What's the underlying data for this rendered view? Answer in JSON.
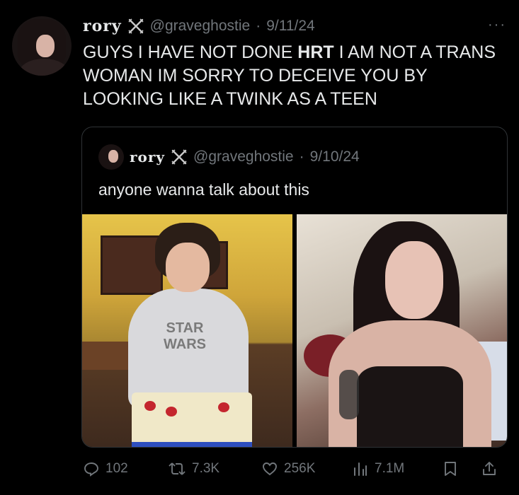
{
  "tweet": {
    "name": "rory",
    "handle": "@graveghostie",
    "separator": "·",
    "date": "9/11/24",
    "text_prefix": "GUYS I HAVE NOT DONE ",
    "text_bold": "HRT",
    "text_suffix": " I AM NOT A TRANS WOMAN IM SORRY TO DECEIVE YOU BY LOOKING LIKE A TWINK AS A TEEN",
    "more": "···"
  },
  "quote": {
    "name": "rory",
    "handle": "@graveghostie",
    "separator": "·",
    "date": "9/10/24",
    "text": "anyone wanna talk about this",
    "left_photo_shirt_text": "STAR WARS"
  },
  "actions": {
    "replies": "102",
    "retweets": "7.3K",
    "likes": "256K",
    "views": "7.1M"
  },
  "colors": {
    "background": "#000000",
    "text": "#e7e9ea",
    "muted": "#71767b",
    "border": "#2f3336"
  },
  "icons": [
    "swords-icon",
    "reply-icon",
    "retweet-icon",
    "heart-icon",
    "views-icon",
    "bookmark-icon",
    "share-icon",
    "more-icon"
  ]
}
